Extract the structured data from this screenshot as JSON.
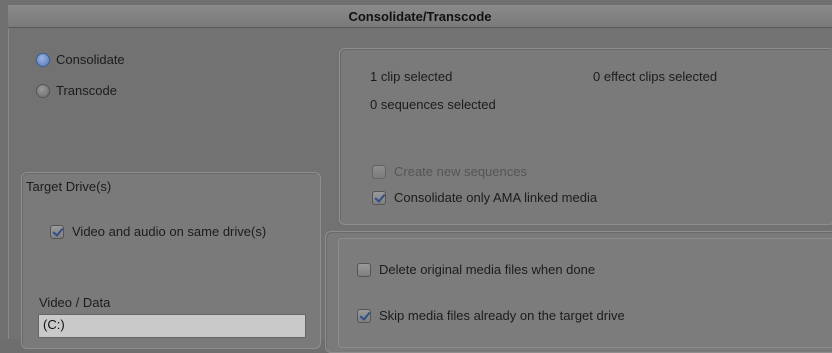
{
  "window": {
    "title": "Consolidate/Transcode"
  },
  "mode": {
    "options": [
      {
        "label": "Consolidate",
        "selected": true
      },
      {
        "label": "Transcode",
        "selected": false
      }
    ]
  },
  "summary": {
    "clips_selected": "1 clip selected",
    "effect_clips_selected": "0 effect clips selected",
    "sequences_selected": "0 sequences selected",
    "create_new_sequences": {
      "label": "Create new sequences",
      "checked": false,
      "enabled": false
    },
    "consolidate_ama": {
      "label": "Consolidate only AMA linked media",
      "checked": true
    }
  },
  "target": {
    "title": "Target Drive(s)",
    "same_drive": {
      "label": "Video and audio on same drive(s)",
      "checked": true
    },
    "video_data_label": "Video / Data",
    "video_data_value": "(C:)"
  },
  "options": {
    "delete_original": {
      "label": "Delete original media files when done",
      "checked": false
    },
    "skip_media": {
      "label": "Skip media files already on the target drive",
      "checked": true
    }
  }
}
